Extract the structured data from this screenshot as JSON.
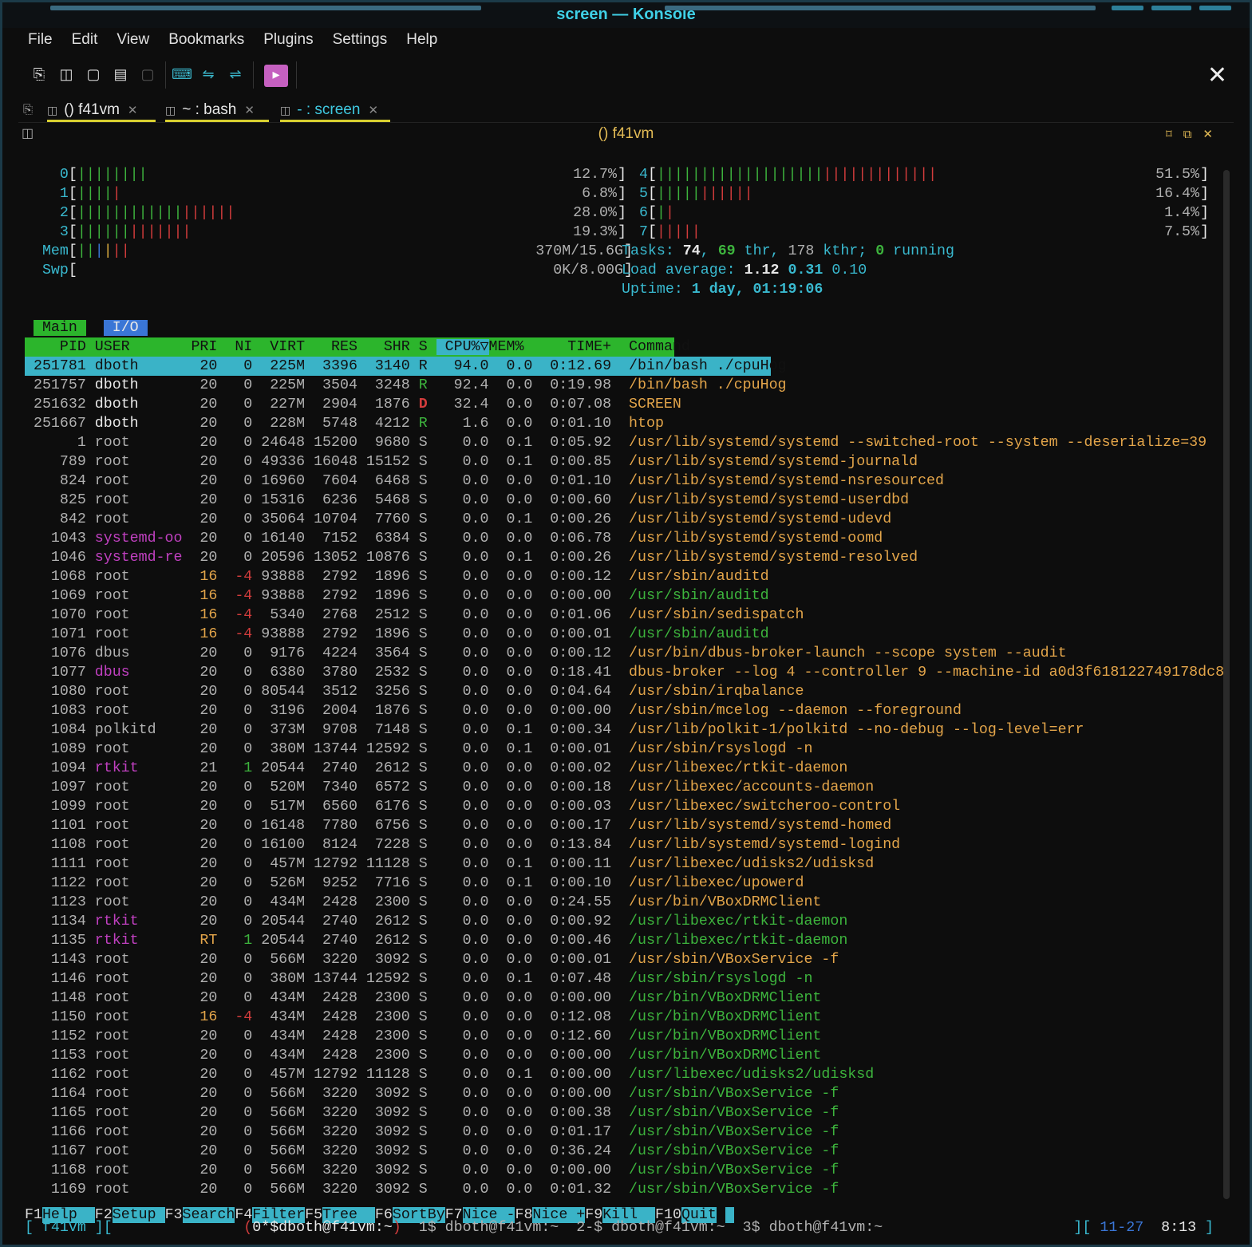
{
  "window": {
    "title": "screen — Konsole"
  },
  "menu": [
    "File",
    "Edit",
    "View",
    "Bookmarks",
    "Plugins",
    "Settings",
    "Help"
  ],
  "tabs": [
    {
      "label": "() f41vm"
    },
    {
      "label": "~ : bash"
    },
    {
      "label": "- : screen"
    }
  ],
  "pane_title": "() f41vm",
  "cpus": [
    {
      "id": "0",
      "bars_green": 8,
      "bars_red": 0,
      "pct": "12.7%"
    },
    {
      "id": "1",
      "bars_green": 4,
      "bars_red": 1,
      "pct": "6.8%"
    },
    {
      "id": "2",
      "bars_green": 12,
      "bars_red": 6,
      "pct": "28.0%"
    },
    {
      "id": "3",
      "bars_green": 6,
      "bars_red": 7,
      "pct": "19.3%"
    },
    {
      "id": "4",
      "bars_green": 19,
      "bars_red": 13,
      "pct": "51.5%"
    },
    {
      "id": "5",
      "bars_green": 5,
      "bars_red": 6,
      "pct": "16.4%"
    },
    {
      "id": "6",
      "bars_green": 1,
      "bars_red": 1,
      "pct": "1.4%"
    },
    {
      "id": "7",
      "bars_green": 0,
      "bars_red": 5,
      "pct": "7.5%"
    }
  ],
  "mem": {
    "label": "Mem",
    "value": "370M/15.6G"
  },
  "swp": {
    "label": "Swp",
    "value": "0K/8.00G"
  },
  "tasks": {
    "label": "Tasks:",
    "count": "74",
    "thr": "69",
    "kthr": "178",
    "running": "0"
  },
  "load": {
    "label": "Load average:",
    "l1": "1.12",
    "l5": "0.31",
    "l15": "0.10"
  },
  "uptime": {
    "label": "Uptime:",
    "value": "1 day, 01:19:06"
  },
  "screen_tabs": [
    "Main",
    "I/O"
  ],
  "columns": [
    "PID",
    "USER",
    "PRI",
    "NI",
    "VIRT",
    "RES",
    "SHR",
    "S",
    "CPU%▽",
    "MEM%",
    "TIME+",
    "Command"
  ],
  "processes": [
    [
      "251781",
      "dboth",
      "20",
      "0",
      "225M",
      "3396",
      "3140",
      "R",
      "94.0",
      "0.0",
      "0:12.69",
      "/bin/bash ./cpuHog"
    ],
    [
      "251757",
      "dboth",
      "20",
      "0",
      "225M",
      "3504",
      "3248",
      "R",
      "92.4",
      "0.0",
      "0:19.98",
      "/bin/bash ./cpuHog"
    ],
    [
      "251632",
      "dboth",
      "20",
      "0",
      "227M",
      "2904",
      "1876",
      "D",
      "32.4",
      "0.0",
      "0:07.08",
      "SCREEN"
    ],
    [
      "251667",
      "dboth",
      "20",
      "0",
      "228M",
      "5748",
      "4212",
      "R",
      "1.6",
      "0.0",
      "0:01.10",
      "htop"
    ],
    [
      "1",
      "root",
      "20",
      "0",
      "24648",
      "15200",
      "9680",
      "S",
      "0.0",
      "0.1",
      "0:05.92",
      "/usr/lib/systemd/systemd --switched-root --system --deserialize=39"
    ],
    [
      "789",
      "root",
      "20",
      "0",
      "49336",
      "16048",
      "15152",
      "S",
      "0.0",
      "0.1",
      "0:00.85",
      "/usr/lib/systemd/systemd-journald"
    ],
    [
      "824",
      "root",
      "20",
      "0",
      "16960",
      "7604",
      "6468",
      "S",
      "0.0",
      "0.0",
      "0:01.10",
      "/usr/lib/systemd/systemd-nsresourced"
    ],
    [
      "825",
      "root",
      "20",
      "0",
      "15316",
      "6236",
      "5468",
      "S",
      "0.0",
      "0.0",
      "0:00.60",
      "/usr/lib/systemd/systemd-userdbd"
    ],
    [
      "842",
      "root",
      "20",
      "0",
      "35064",
      "10704",
      "7760",
      "S",
      "0.0",
      "0.1",
      "0:00.26",
      "/usr/lib/systemd/systemd-udevd"
    ],
    [
      "1043",
      "systemd-oo",
      "20",
      "0",
      "16140",
      "7152",
      "6384",
      "S",
      "0.0",
      "0.0",
      "0:06.78",
      "/usr/lib/systemd/systemd-oomd"
    ],
    [
      "1046",
      "systemd-re",
      "20",
      "0",
      "20596",
      "13052",
      "10876",
      "S",
      "0.0",
      "0.1",
      "0:00.26",
      "/usr/lib/systemd/systemd-resolved"
    ],
    [
      "1068",
      "root",
      "16",
      "-4",
      "93888",
      "2792",
      "1896",
      "S",
      "0.0",
      "0.0",
      "0:00.12",
      "/usr/sbin/auditd"
    ],
    [
      "1069",
      "root",
      "16",
      "-4",
      "93888",
      "2792",
      "1896",
      "S",
      "0.0",
      "0.0",
      "0:00.00",
      "/usr/sbin/auditd"
    ],
    [
      "1070",
      "root",
      "16",
      "-4",
      "5340",
      "2768",
      "2512",
      "S",
      "0.0",
      "0.0",
      "0:01.06",
      "/usr/sbin/sedispatch"
    ],
    [
      "1071",
      "root",
      "16",
      "-4",
      "93888",
      "2792",
      "1896",
      "S",
      "0.0",
      "0.0",
      "0:00.01",
      "/usr/sbin/auditd"
    ],
    [
      "1076",
      "dbus",
      "20",
      "0",
      "9176",
      "4224",
      "3564",
      "S",
      "0.0",
      "0.0",
      "0:00.12",
      "/usr/bin/dbus-broker-launch --scope system --audit"
    ],
    [
      "1077",
      "dbus",
      "20",
      "0",
      "6380",
      "3780",
      "2532",
      "S",
      "0.0",
      "0.0",
      "0:18.41",
      "dbus-broker --log 4 --controller 9 --machine-id a0d3f618122749178dc8"
    ],
    [
      "1080",
      "root",
      "20",
      "0",
      "80544",
      "3512",
      "3256",
      "S",
      "0.0",
      "0.0",
      "0:04.64",
      "/usr/sbin/irqbalance"
    ],
    [
      "1083",
      "root",
      "20",
      "0",
      "3196",
      "2004",
      "1876",
      "S",
      "0.0",
      "0.0",
      "0:00.00",
      "/usr/sbin/mcelog --daemon --foreground"
    ],
    [
      "1084",
      "polkitd",
      "20",
      "0",
      "373M",
      "9708",
      "7148",
      "S",
      "0.0",
      "0.1",
      "0:00.34",
      "/usr/lib/polkit-1/polkitd --no-debug --log-level=err"
    ],
    [
      "1089",
      "root",
      "20",
      "0",
      "380M",
      "13744",
      "12592",
      "S",
      "0.0",
      "0.1",
      "0:00.01",
      "/usr/sbin/rsyslogd -n"
    ],
    [
      "1094",
      "rtkit",
      "21",
      "1",
      "20544",
      "2740",
      "2612",
      "S",
      "0.0",
      "0.0",
      "0:00.02",
      "/usr/libexec/rtkit-daemon"
    ],
    [
      "1097",
      "root",
      "20",
      "0",
      "520M",
      "7340",
      "6572",
      "S",
      "0.0",
      "0.0",
      "0:00.18",
      "/usr/libexec/accounts-daemon"
    ],
    [
      "1099",
      "root",
      "20",
      "0",
      "517M",
      "6560",
      "6176",
      "S",
      "0.0",
      "0.0",
      "0:00.03",
      "/usr/libexec/switcheroo-control"
    ],
    [
      "1101",
      "root",
      "20",
      "0",
      "16148",
      "7780",
      "6756",
      "S",
      "0.0",
      "0.0",
      "0:00.17",
      "/usr/lib/systemd/systemd-homed"
    ],
    [
      "1108",
      "root",
      "20",
      "0",
      "16100",
      "8124",
      "7228",
      "S",
      "0.0",
      "0.0",
      "0:13.84",
      "/usr/lib/systemd/systemd-logind"
    ],
    [
      "1111",
      "root",
      "20",
      "0",
      "457M",
      "12792",
      "11128",
      "S",
      "0.0",
      "0.1",
      "0:00.11",
      "/usr/libexec/udisks2/udisksd"
    ],
    [
      "1122",
      "root",
      "20",
      "0",
      "526M",
      "9252",
      "7716",
      "S",
      "0.0",
      "0.1",
      "0:00.10",
      "/usr/libexec/upowerd"
    ],
    [
      "1123",
      "root",
      "20",
      "0",
      "434M",
      "2428",
      "2300",
      "S",
      "0.0",
      "0.0",
      "0:24.55",
      "/usr/bin/VBoxDRMClient"
    ],
    [
      "1134",
      "rtkit",
      "20",
      "0",
      "20544",
      "2740",
      "2612",
      "S",
      "0.0",
      "0.0",
      "0:00.92",
      "/usr/libexec/rtkit-daemon"
    ],
    [
      "1135",
      "rtkit",
      "RT",
      "1",
      "20544",
      "2740",
      "2612",
      "S",
      "0.0",
      "0.0",
      "0:00.46",
      "/usr/libexec/rtkit-daemon"
    ],
    [
      "1143",
      "root",
      "20",
      "0",
      "566M",
      "3220",
      "3092",
      "S",
      "0.0",
      "0.0",
      "0:00.01",
      "/usr/sbin/VBoxService -f"
    ],
    [
      "1146",
      "root",
      "20",
      "0",
      "380M",
      "13744",
      "12592",
      "S",
      "0.0",
      "0.1",
      "0:07.48",
      "/usr/sbin/rsyslogd -n"
    ],
    [
      "1148",
      "root",
      "20",
      "0",
      "434M",
      "2428",
      "2300",
      "S",
      "0.0",
      "0.0",
      "0:00.00",
      "/usr/bin/VBoxDRMClient"
    ],
    [
      "1150",
      "root",
      "16",
      "-4",
      "434M",
      "2428",
      "2300",
      "S",
      "0.0",
      "0.0",
      "0:12.08",
      "/usr/bin/VBoxDRMClient"
    ],
    [
      "1152",
      "root",
      "20",
      "0",
      "434M",
      "2428",
      "2300",
      "S",
      "0.0",
      "0.0",
      "0:12.60",
      "/usr/bin/VBoxDRMClient"
    ],
    [
      "1153",
      "root",
      "20",
      "0",
      "434M",
      "2428",
      "2300",
      "S",
      "0.0",
      "0.0",
      "0:00.00",
      "/usr/bin/VBoxDRMClient"
    ],
    [
      "1162",
      "root",
      "20",
      "0",
      "457M",
      "12792",
      "11128",
      "S",
      "0.0",
      "0.1",
      "0:00.00",
      "/usr/libexec/udisks2/udisksd"
    ],
    [
      "1164",
      "root",
      "20",
      "0",
      "566M",
      "3220",
      "3092",
      "S",
      "0.0",
      "0.0",
      "0:00.00",
      "/usr/sbin/VBoxService -f"
    ],
    [
      "1165",
      "root",
      "20",
      "0",
      "566M",
      "3220",
      "3092",
      "S",
      "0.0",
      "0.0",
      "0:00.38",
      "/usr/sbin/VBoxService -f"
    ],
    [
      "1166",
      "root",
      "20",
      "0",
      "566M",
      "3220",
      "3092",
      "S",
      "0.0",
      "0.0",
      "0:01.17",
      "/usr/sbin/VBoxService -f"
    ],
    [
      "1167",
      "root",
      "20",
      "0",
      "566M",
      "3220",
      "3092",
      "S",
      "0.0",
      "0.0",
      "0:36.24",
      "/usr/sbin/VBoxService -f"
    ],
    [
      "1168",
      "root",
      "20",
      "0",
      "566M",
      "3220",
      "3092",
      "S",
      "0.0",
      "0.0",
      "0:00.00",
      "/usr/sbin/VBoxService -f"
    ],
    [
      "1169",
      "root",
      "20",
      "0",
      "566M",
      "3220",
      "3092",
      "S",
      "0.0",
      "0.0",
      "0:01.32",
      "/usr/sbin/VBoxService -f"
    ]
  ],
  "thread_rows": [
    "1069",
    "1071",
    "1134",
    "1135",
    "1146",
    "1148",
    "1150",
    "1152",
    "1153",
    "1162",
    "1164",
    "1165",
    "1166",
    "1167",
    "1168",
    "1169"
  ],
  "fkeys": [
    {
      "key": "F1",
      "label": "Help  "
    },
    {
      "key": "F2",
      "label": "Setup "
    },
    {
      "key": "F3",
      "label": "Search"
    },
    {
      "key": "F4",
      "label": "Filter"
    },
    {
      "key": "F5",
      "label": "Tree  "
    },
    {
      "key": "F6",
      "label": "SortBy"
    },
    {
      "key": "F7",
      "label": "Nice -"
    },
    {
      "key": "F8",
      "label": "Nice +"
    },
    {
      "key": "F9",
      "label": "Kill  "
    },
    {
      "key": "F10",
      "label": "Quit"
    }
  ],
  "screen_status": {
    "host": "[ f41vm ][",
    "w0": "(0*$dboth@f41vm:~)",
    "w1": "1$ dboth@f41vm:~",
    "w2": "2-$ dboth@f41vm:~",
    "w3": "3$ dboth@f41vm:~",
    "date": "11-27",
    "time": "8:13",
    "close": "]"
  },
  "colors": {
    "accent": "#3ab3c7",
    "header_bg": "#2cb52c",
    "bar_green": "#3db43d",
    "bar_red": "#d23c3c"
  }
}
